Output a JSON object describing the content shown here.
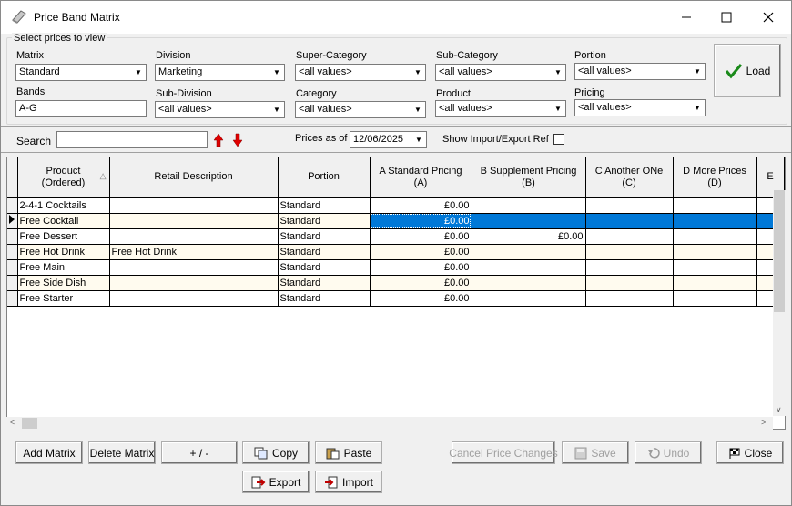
{
  "window": {
    "title": "Price Band Matrix",
    "minimize": "—",
    "maximize": "☐",
    "close": "✕"
  },
  "filters": {
    "group_label": "Select prices to view",
    "matrix": {
      "label": "Matrix",
      "value": "Standard"
    },
    "division": {
      "label": "Division",
      "value": "Marketing"
    },
    "super_category": {
      "label": "Super-Category",
      "value": "<all values>"
    },
    "sub_category": {
      "label": "Sub-Category",
      "value": "<all values>"
    },
    "portion": {
      "label": "Portion",
      "value": "<all values>"
    },
    "bands": {
      "label": "Bands",
      "value": "A-G"
    },
    "sub_division": {
      "label": "Sub-Division",
      "value": "<all values>"
    },
    "category": {
      "label": "Category",
      "value": "<all values>"
    },
    "product": {
      "label": "Product",
      "value": "<all values>"
    },
    "pricing": {
      "label": "Pricing",
      "value": "<all values>"
    },
    "load_label": "Load"
  },
  "search": {
    "label": "Search",
    "value": "",
    "prices_as_of_label": "Prices as of",
    "prices_as_of_value": "12/06/2025",
    "show_import_label": "Show Import/Export Ref"
  },
  "grid": {
    "headers": [
      {
        "line1": "Product",
        "line2": "(Ordered)"
      },
      {
        "line1": "Retail Description",
        "line2": ""
      },
      {
        "line1": "Portion",
        "line2": ""
      },
      {
        "line1": "A Standard Pricing",
        "line2": "(A)"
      },
      {
        "line1": "B Supplement Pricing",
        "line2": "(B)"
      },
      {
        "line1": "C Another ONe",
        "line2": "(C)"
      },
      {
        "line1": "D More Prices",
        "line2": "(D)"
      },
      {
        "line1": "E",
        "line2": ""
      }
    ],
    "rows": [
      {
        "product": "2-4-1 Cocktails",
        "desc": "",
        "portion": "Standard",
        "a": "£0.00",
        "b": "",
        "c": "",
        "d": ""
      },
      {
        "product": "Free Cocktail",
        "desc": "",
        "portion": "Standard",
        "a": "£0.00",
        "b": "",
        "c": "",
        "d": ""
      },
      {
        "product": "Free Dessert",
        "desc": "",
        "portion": "Standard",
        "a": "£0.00",
        "b": "£0.00",
        "c": "",
        "d": ""
      },
      {
        "product": "Free Hot Drink",
        "desc": "Free Hot Drink",
        "portion": "Standard",
        "a": "£0.00",
        "b": "",
        "c": "",
        "d": ""
      },
      {
        "product": "Free Main",
        "desc": "",
        "portion": "Standard",
        "a": "£0.00",
        "b": "",
        "c": "",
        "d": ""
      },
      {
        "product": "Free Side Dish",
        "desc": "",
        "portion": "Standard",
        "a": "£0.00",
        "b": "",
        "c": "",
        "d": ""
      },
      {
        "product": "Free Starter",
        "desc": "",
        "portion": "Standard",
        "a": "£0.00",
        "b": "",
        "c": "",
        "d": ""
      }
    ]
  },
  "buttons": {
    "add_matrix": "Add Matrix",
    "delete_matrix": "Delete Matrix",
    "plus_minus": "+ / -",
    "copy": "Copy",
    "paste": "Paste",
    "cancel_changes": "Cancel Price Changes",
    "save": "Save",
    "undo": "Undo",
    "close": "Close",
    "export": "Export",
    "import": "Import"
  }
}
